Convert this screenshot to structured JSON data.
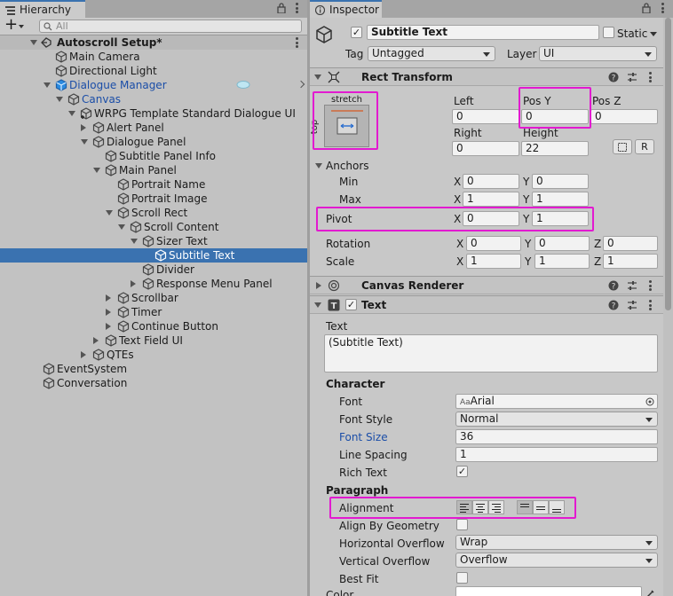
{
  "hierarchy": {
    "tab_label": "Hierarchy",
    "search_placeholder": "All",
    "add_label": "+",
    "scene_name": "Autoscroll Setup*",
    "rows": [
      {
        "label": "Main Camera",
        "depth": 1,
        "expand": "none",
        "icon": "cube-icon",
        "style": "normal"
      },
      {
        "label": "Directional Light",
        "depth": 1,
        "expand": "none",
        "icon": "cube-icon",
        "style": "normal"
      },
      {
        "label": "Dialogue Manager",
        "depth": 1,
        "expand": "down",
        "icon": "prefab-cube-icon",
        "style": "blue"
      },
      {
        "label": "Canvas",
        "depth": 2,
        "expand": "down",
        "icon": "cube-icon",
        "style": "blue"
      },
      {
        "label": "WRPG Template Standard Dialogue UI",
        "depth": 3,
        "expand": "down",
        "icon": "cube-plus-icon",
        "style": "normal"
      },
      {
        "label": "Alert Panel",
        "depth": 4,
        "expand": "right",
        "icon": "cube-icon",
        "style": "normal"
      },
      {
        "label": "Dialogue Panel",
        "depth": 4,
        "expand": "down",
        "icon": "cube-icon",
        "style": "normal"
      },
      {
        "label": "Subtitle Panel Info",
        "depth": 5,
        "expand": "none",
        "icon": "cube-icon",
        "style": "normal"
      },
      {
        "label": "Main Panel",
        "depth": 5,
        "expand": "down",
        "icon": "cube-icon",
        "style": "normal"
      },
      {
        "label": "Portrait Name",
        "depth": 6,
        "expand": "none",
        "icon": "cube-icon",
        "style": "normal"
      },
      {
        "label": "Portrait Image",
        "depth": 6,
        "expand": "none",
        "icon": "cube-icon",
        "style": "normal"
      },
      {
        "label": "Scroll Rect",
        "depth": 6,
        "expand": "down",
        "icon": "cube-icon",
        "style": "normal"
      },
      {
        "label": "Scroll Content",
        "depth": 7,
        "expand": "down",
        "icon": "cube-icon",
        "style": "normal"
      },
      {
        "label": "Sizer Text",
        "depth": 8,
        "expand": "down",
        "icon": "cube-icon",
        "style": "normal"
      },
      {
        "label": "Subtitle Text",
        "depth": 9,
        "expand": "none",
        "icon": "cube-icon",
        "style": "selected"
      },
      {
        "label": "Divider",
        "depth": 8,
        "expand": "none",
        "icon": "cube-icon",
        "style": "normal"
      },
      {
        "label": "Response Menu Panel",
        "depth": 8,
        "expand": "right",
        "icon": "cube-icon",
        "style": "normal"
      },
      {
        "label": "Scrollbar",
        "depth": 6,
        "expand": "right",
        "icon": "cube-icon",
        "style": "normal"
      },
      {
        "label": "Timer",
        "depth": 6,
        "expand": "right",
        "icon": "cube-icon",
        "style": "normal"
      },
      {
        "label": "Continue Button",
        "depth": 6,
        "expand": "right",
        "icon": "cube-icon",
        "style": "normal"
      },
      {
        "label": "Text Field UI",
        "depth": 5,
        "expand": "right",
        "icon": "cube-icon",
        "style": "normal"
      },
      {
        "label": "QTEs",
        "depth": 4,
        "expand": "right",
        "icon": "cube-icon",
        "style": "normal"
      },
      {
        "label": "EventSystem",
        "depth": 0,
        "expand": "none",
        "icon": "cube-icon",
        "style": "normal"
      },
      {
        "label": "Conversation",
        "depth": 0,
        "expand": "none",
        "icon": "cube-icon",
        "style": "normal"
      }
    ]
  },
  "inspector": {
    "tab_label": "Inspector",
    "object_name": "Subtitle Text",
    "static_label": "Static",
    "tag_label": "Tag",
    "tag_value": "Untagged",
    "layer_label": "Layer",
    "layer_value": "UI",
    "rect_transform": {
      "title": "Rect Transform",
      "anchor_preset_h": "stretch",
      "anchor_preset_v": "top",
      "left_label": "Left",
      "left_value": "0",
      "posy_label": "Pos Y",
      "posy_value": "0",
      "posz_label": "Pos Z",
      "posz_value": "0",
      "right_label": "Right",
      "right_value": "0",
      "height_label": "Height",
      "height_value": "22",
      "raw_button": "R",
      "anchors_label": "Anchors",
      "min_label": "Min",
      "min_x": "0",
      "min_y": "0",
      "max_label": "Max",
      "max_x": "1",
      "max_y": "1",
      "pivot_label": "Pivot",
      "pivot_x": "0",
      "pivot_y": "1",
      "rotation_label": "Rotation",
      "rot_x": "0",
      "rot_y": "0",
      "rot_z": "0",
      "scale_label": "Scale",
      "scale_x": "1",
      "scale_y": "1",
      "scale_z": "1",
      "x_label": "X",
      "y_label": "Y",
      "z_label": "Z"
    },
    "canvas_renderer": {
      "title": "Canvas Renderer"
    },
    "text": {
      "title": "Text",
      "text_label": "Text",
      "text_value": "(Subtitle Text)",
      "character_label": "Character",
      "font_label": "Font",
      "font_value": "Arial",
      "font_prefix": "Aa",
      "font_style_label": "Font Style",
      "font_style_value": "Normal",
      "font_size_label": "Font Size",
      "font_size_value": "36",
      "line_spacing_label": "Line Spacing",
      "line_spacing_value": "1",
      "rich_text_label": "Rich Text",
      "paragraph_label": "Paragraph",
      "alignment_label": "Alignment",
      "align_by_geometry_label": "Align By Geometry",
      "h_overflow_label": "Horizontal Overflow",
      "h_overflow_value": "Wrap",
      "v_overflow_label": "Vertical Overflow",
      "v_overflow_value": "Overflow",
      "best_fit_label": "Best Fit",
      "color_label": "Color"
    }
  },
  "colors": {
    "highlight": "#e21ad0",
    "selection": "#3a72b0",
    "blue_text": "#1b4ea8"
  }
}
